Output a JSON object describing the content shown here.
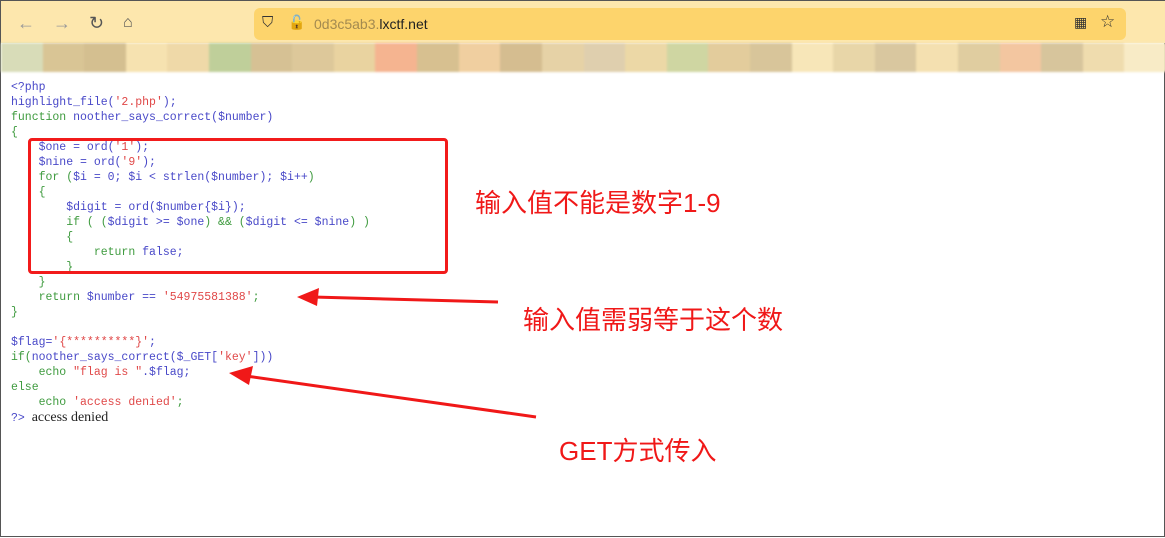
{
  "browser": {
    "url_subdomain": "0d3c5ab3.",
    "url_domain": "lxctf.net",
    "icons": [
      "back-icon",
      "forward-icon",
      "reload-icon",
      "home-icon",
      "shield-icon",
      "insecure-lock-icon",
      "qr-icon",
      "star-icon"
    ]
  },
  "code": {
    "l1": "<?php",
    "l2a": "highlight_file(",
    "l2b": "'2.php'",
    "l2c": ");",
    "l3a": "function ",
    "l3b": "noother_says_correct(",
    "l3c": "$number",
    ")": ")",
    "l4": "{",
    "l5a": "    $one = ord(",
    "l5b": "'1'",
    "l5c": ");",
    "l6a": "    $nine = ord(",
    "l6b": "'9'",
    "l6c": ");",
    "l7a": "    for (",
    "l7b": "$i = 0; $i < strlen($number); $i++",
    "l8": "    {",
    "l9": "        $digit = ord($number{$i});",
    "l10a": "        if ( (",
    "l10b": "$digit >= $one",
    ") && (": ") && (",
    "l10c": "$digit <= $nine",
    "l10d": ") )",
    "l11": "        {",
    "l12a": "            return ",
    "l12b": "false;",
    "l13": "        }",
    "l14": "    }",
    "l15a": "    return ",
    "l15b": "$number == ",
    "l15c": "'54975581388'",
    "l15d": ";",
    "l16": "}",
    "l18a": "$flag=",
    "l18b": "'{**********}'",
    "l18c": ";",
    "l19a": "if(",
    "l19b": "noother_says_correct(",
    "l19c": "$_GET[",
    "l19d": "'key'",
    "l19e": "]))",
    "l20a": "    echo ",
    "l20b": "\"flag is \"",
    "l20c": ".$flag;",
    "l21": "else",
    "l22a": "    echo ",
    "l22b": "'access denied'",
    "l22c": ";",
    "l23": "?>",
    "output": "access denied"
  },
  "annotations": {
    "a1": "输入值不能是数字1-9",
    "a2": "输入值需弱等于这个数",
    "a3": "GET方式传入"
  },
  "colors": {
    "annotation": "#f01818",
    "keyword": "#3f9b3f",
    "string": "#e04848",
    "default": "#4848c8"
  }
}
